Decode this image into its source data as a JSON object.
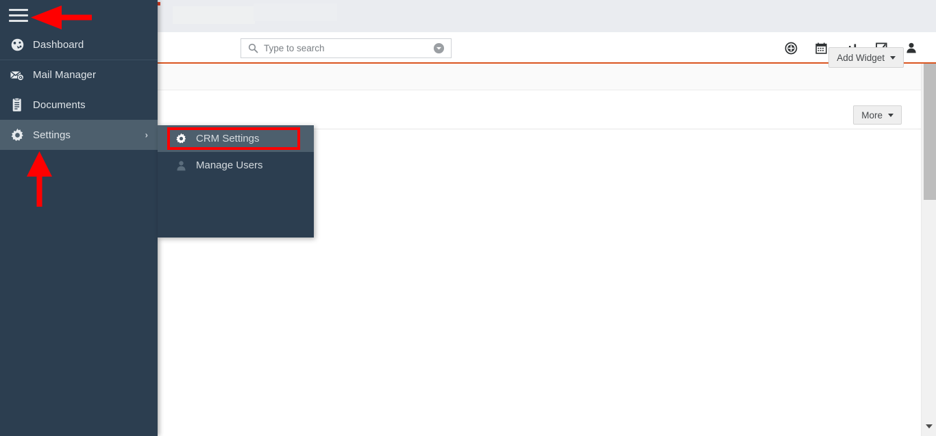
{
  "sidebar": {
    "menu_toggle": "menu-toggle",
    "items": [
      {
        "label": "Dashboard",
        "icon": "dashboard-gauge-icon",
        "active": false,
        "has_submenu": false
      },
      {
        "label": "Mail Manager",
        "icon": "mail-envelope-at-icon",
        "active": false,
        "has_submenu": false
      },
      {
        "label": "Documents",
        "icon": "document-icon",
        "active": false,
        "has_submenu": false
      },
      {
        "label": "Settings",
        "icon": "gear-icon",
        "active": true,
        "has_submenu": true,
        "chevron": "›"
      }
    ]
  },
  "submenu": {
    "items": [
      {
        "label": "CRM Settings",
        "icon": "gear-icon",
        "highlighted": true
      },
      {
        "label": "Manage Users",
        "icon": "user-icon",
        "highlighted": false
      }
    ]
  },
  "header": {
    "search": {
      "placeholder": "Type to search",
      "value": "",
      "search_icon": "search-icon",
      "dropdown_icon": "chevron-down-circle-icon"
    },
    "icons": [
      {
        "name": "add-circle-icon",
        "title": "Add"
      },
      {
        "name": "calendar-icon",
        "title": "Calendar"
      },
      {
        "name": "bar-chart-icon",
        "title": "Reports"
      },
      {
        "name": "checkbox-task-icon",
        "title": "Tasks"
      },
      {
        "name": "user-profile-icon",
        "title": "Profile"
      }
    ]
  },
  "toolbar": {
    "more_label": "More",
    "add_widget_label": "Add Widget"
  },
  "annotations": {
    "arrow_to_menu_toggle": "red-arrow-left",
    "arrow_to_settings": "red-arrow-up",
    "highlight_target": "CRM Settings"
  },
  "colors": {
    "sidebar_bg": "#2c3e50",
    "sidebar_active": "#4d5f6d",
    "accent_orange": "#d9531e",
    "annotation_red": "#ff0000",
    "content_bg": "#ffffff"
  },
  "scrollbar": {
    "orientation": "vertical",
    "down_arrow_icon": "chevron-down-icon"
  }
}
